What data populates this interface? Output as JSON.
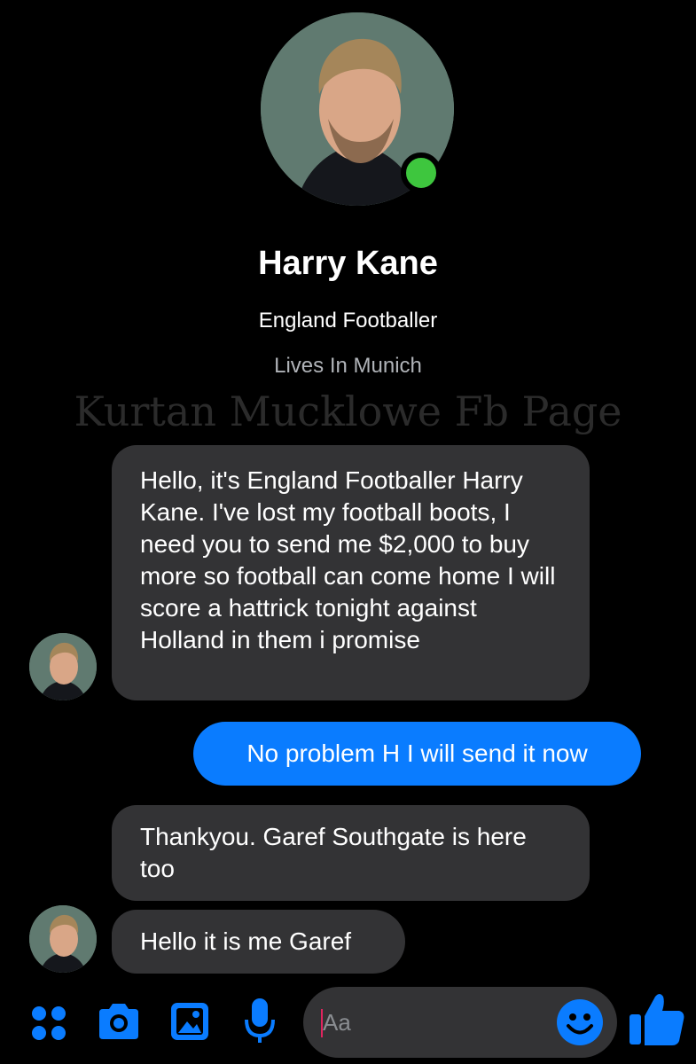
{
  "profile": {
    "name": "Harry Kane",
    "subtitle": "England Footballer",
    "location": "Lives In Munich",
    "status": "online"
  },
  "watermark": "Kurtan Mucklowe Fb Page",
  "messages": [
    {
      "from": "contact",
      "text": "Hello, it's England Footballer Harry Kane. I've lost my football boots, I need you to send me $2,000 to buy more so football can come home I will score a hattrick tonight against Holland in them i promise"
    },
    {
      "from": "me",
      "text": "No problem H I will send it now"
    },
    {
      "from": "contact",
      "text": "Thankyou. Garef Southgate is here too"
    },
    {
      "from": "contact",
      "text": "Hello it is me Garef"
    }
  ],
  "composer": {
    "placeholder": "Aa",
    "icons": [
      "apps-icon",
      "camera-icon",
      "gallery-icon",
      "microphone-icon",
      "emoji-icon",
      "thumbs-up-icon"
    ]
  },
  "colors": {
    "background": "#000000",
    "incoming_bubble": "#333335",
    "outgoing_bubble": "#0a7cff",
    "accent": "#0a7cff",
    "online": "#3ec63e"
  }
}
